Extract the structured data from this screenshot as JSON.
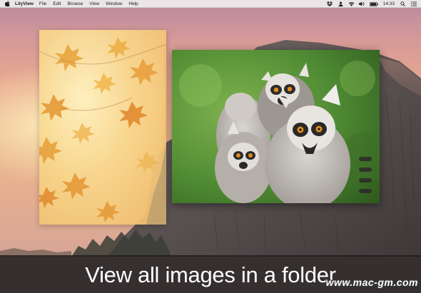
{
  "menubar": {
    "app_name": "LilyView",
    "items": [
      "File",
      "Edit",
      "Browse",
      "View",
      "Window",
      "Help"
    ],
    "clock": "14:33"
  },
  "icons": {
    "apple": "apple-icon",
    "dropbox": "dropbox-icon",
    "user": "user-icon",
    "wifi": "wifi-icon",
    "volume": "volume-icon",
    "battery": "battery-icon",
    "search": "search-icon",
    "list": "list-icon"
  },
  "images": [
    {
      "name": "autumn-leaves",
      "kind": "wallpaper image"
    },
    {
      "name": "ring-tailed-lemurs",
      "kind": "photo"
    }
  ],
  "caption": "View all images in a folder",
  "watermark": "www.mac-gm.com",
  "colors": {
    "caption_bar": "#1c1c1e",
    "menubar": "#eeecee",
    "sky_top": "#b98aa0",
    "sky_mid": "#eab58c"
  }
}
